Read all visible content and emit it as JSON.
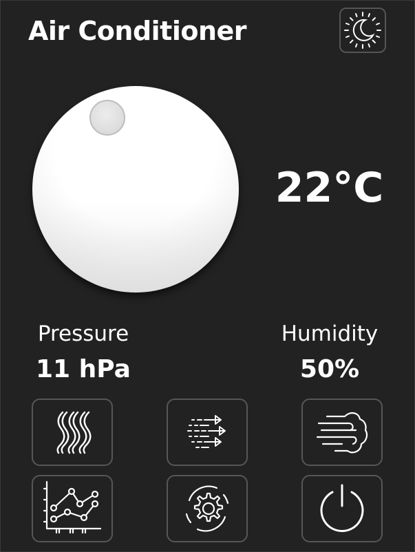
{
  "app": {
    "title": "Air Conditioner"
  },
  "header": {
    "mode_icon": "sun-moon-icon"
  },
  "thermostat": {
    "temperature": "22°C",
    "knob_icon": "dial-knob"
  },
  "stats": {
    "pressure": {
      "label": "Pressure",
      "value": "11 hPa"
    },
    "humidity": {
      "label": "Humidity",
      "value": "50%"
    }
  },
  "controls": [
    {
      "name": "heat-waves-icon"
    },
    {
      "name": "airflow-arrows-icon"
    },
    {
      "name": "wind-icon"
    },
    {
      "name": "chart-icon"
    },
    {
      "name": "settings-gear-icon"
    },
    {
      "name": "power-icon"
    }
  ],
  "colors": {
    "background": "#222222",
    "foreground": "#ffffff",
    "border": "#575757"
  }
}
